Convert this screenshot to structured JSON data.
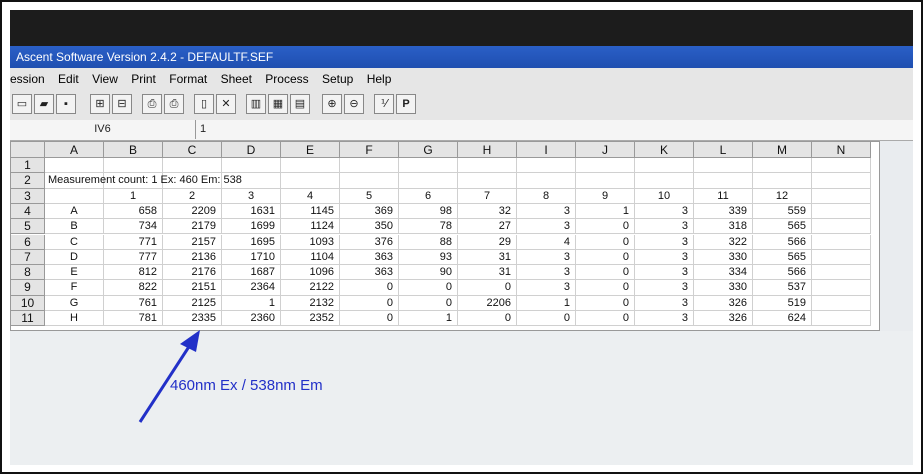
{
  "window": {
    "title": "Ascent Software Version 2.4.2  - DEFAULTF.SEF"
  },
  "menu": [
    "ession",
    "Edit",
    "View",
    "Print",
    "Format",
    "Sheet",
    "Process",
    "Setup",
    "Help"
  ],
  "toolbar": {
    "p_button": "P"
  },
  "formula_bar": {
    "cell_ref": "IV6",
    "content": "1"
  },
  "sheet": {
    "col_headers": [
      "A",
      "B",
      "C",
      "D",
      "E",
      "F",
      "G",
      "H",
      "I",
      "J",
      "K",
      "L",
      "M",
      "N"
    ],
    "row_headers": [
      "1",
      "2",
      "3",
      "4",
      "5",
      "6",
      "7",
      "8",
      "9",
      "10",
      "11"
    ],
    "row2_text": "Measurement count: 1   Ex: 460  Em: 538",
    "row3_labels": [
      "1",
      "2",
      "3",
      "4",
      "5",
      "6",
      "7",
      "8",
      "9",
      "10",
      "11",
      "12"
    ],
    "rows": [
      {
        "label": "A",
        "values": [
          "658",
          "2209",
          "1631",
          "1145",
          "369",
          "98",
          "32",
          "3",
          "1",
          "3",
          "339",
          "559"
        ]
      },
      {
        "label": "B",
        "values": [
          "734",
          "2179",
          "1699",
          "1124",
          "350",
          "78",
          "27",
          "3",
          "0",
          "3",
          "318",
          "565"
        ]
      },
      {
        "label": "C",
        "values": [
          "771",
          "2157",
          "1695",
          "1093",
          "376",
          "88",
          "29",
          "4",
          "0",
          "3",
          "322",
          "566"
        ]
      },
      {
        "label": "D",
        "values": [
          "777",
          "2136",
          "1710",
          "1104",
          "363",
          "93",
          "31",
          "3",
          "0",
          "3",
          "330",
          "565"
        ]
      },
      {
        "label": "E",
        "values": [
          "812",
          "2176",
          "1687",
          "1096",
          "363",
          "90",
          "31",
          "3",
          "0",
          "3",
          "334",
          "566"
        ]
      },
      {
        "label": "F",
        "values": [
          "822",
          "2151",
          "2364",
          "2122",
          "0",
          "0",
          "0",
          "3",
          "0",
          "3",
          "330",
          "537"
        ]
      },
      {
        "label": "G",
        "values": [
          "761",
          "2125",
          "1",
          "2132",
          "0",
          "0",
          "2206",
          "1",
          "0",
          "3",
          "326",
          "519"
        ]
      },
      {
        "label": "H",
        "values": [
          "781",
          "2335",
          "2360",
          "2352",
          "0",
          "1",
          "0",
          "0",
          "0",
          "3",
          "326",
          "624"
        ]
      }
    ]
  },
  "annotation": {
    "text": "460nm Ex /  538nm Em",
    "color": "#2230c8"
  }
}
